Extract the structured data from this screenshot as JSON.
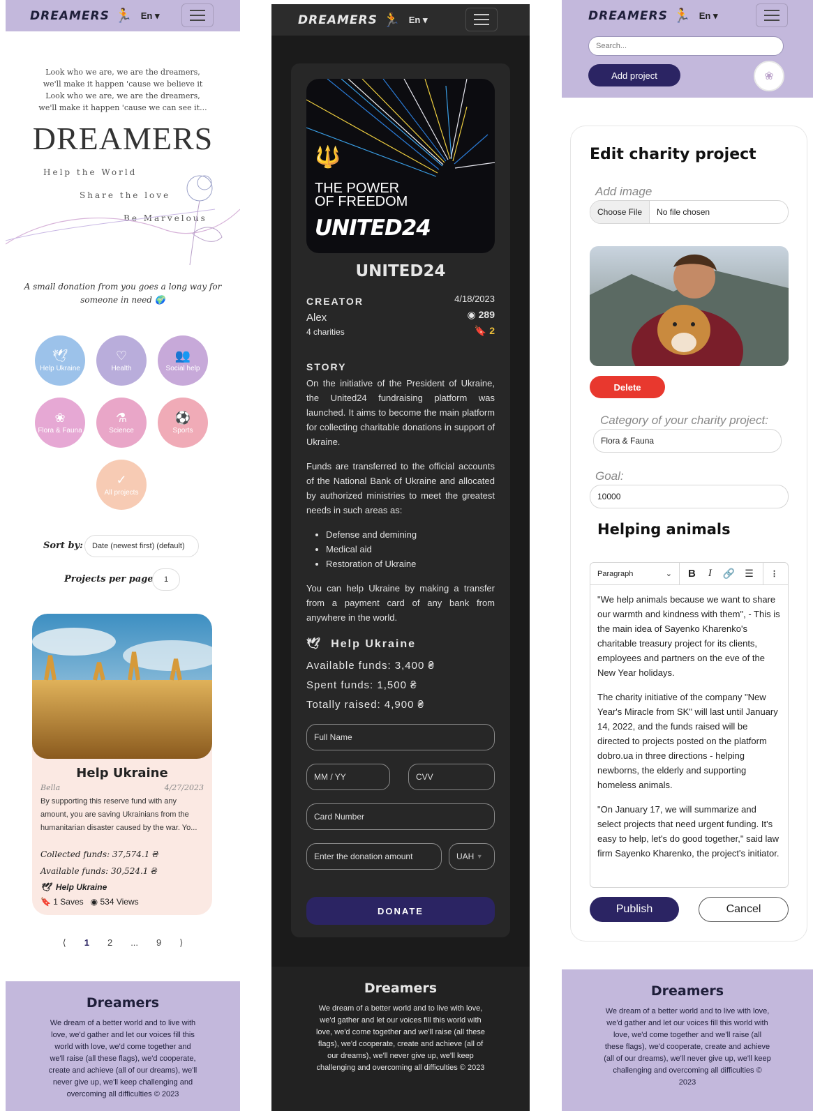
{
  "brand": {
    "logo_text": "DREAMERS",
    "lang": "En",
    "logo_icon": "dreamer-figure-icon",
    "burger_icon": "hamburger-menu-icon"
  },
  "home": {
    "poem": [
      "Look who we are, we are the dreamers,",
      "we'll make it happen 'cause we believe it",
      "Look who we are, we are the dreamers,",
      "we'll make it happen 'cause we can see it..."
    ],
    "big_title": "DREAMERS",
    "taglines": [
      "Help the World",
      "Share the love",
      "Be Marvelous"
    ],
    "subtitle": "A small donation from you goes a long way for someone in need",
    "categories": [
      {
        "label": "Help Ukraine",
        "icon": "dove-icon",
        "color": "#9cc2ea"
      },
      {
        "label": "Health",
        "icon": "heart-pulse-icon",
        "color": "#b9addb"
      },
      {
        "label": "Social help",
        "icon": "people-icon",
        "color": "#c7a9d9"
      },
      {
        "label": "Flora & Fauna",
        "icon": "paw-leaf-icon",
        "color": "#e6a8d4"
      },
      {
        "label": "Science",
        "icon": "flask-icon",
        "color": "#e9a6c8"
      },
      {
        "label": "Sports",
        "icon": "ball-icon",
        "color": "#f0abb7"
      },
      {
        "label": "All projects",
        "icon": "check-icon",
        "color": "#f7cbb4"
      }
    ],
    "sort_label": "Sort by:",
    "sort_value": "Date (newest first) (default)",
    "per_page_label": "Projects per page:",
    "per_page_value": "1",
    "card": {
      "title": "Help Ukraine",
      "author": "Bella",
      "date": "4/27/2023",
      "desc": "By supporting this reserve fund with any amount, you are saving Ukrainians from the humanitarian disaster caused by the war. Yo...",
      "collected": "Collected funds: 37,574.1 ₴",
      "available": "Available funds: 30,524.1 ₴",
      "category": "Help Ukraine",
      "saves": "1 Saves",
      "views": "534 Views"
    },
    "pagination": [
      "⟨",
      "1",
      "2",
      "...",
      "9",
      "⟩"
    ]
  },
  "detail": {
    "poster_line1": "THE POWER",
    "poster_line2": "OF FREEDOM",
    "poster_brand": "UNITED24",
    "title": "UNITED24",
    "creator_label": "CREATOR",
    "creator_name": "Alex",
    "creator_charities": "4 charities",
    "date": "4/18/2023",
    "views": "289",
    "saves": "2",
    "story_label": "STORY",
    "story_p1": "On the initiative of the President of Ukraine, the United24 fundraising platform was launched. It aims to become the main platform for collecting charitable donations in support of Ukraine.",
    "story_p2": "Funds are transferred to the official accounts of the National Bank of Ukraine and allocated by authorized ministries to meet the greatest needs in such areas as:",
    "story_list": [
      "Defense and demining",
      "Medical aid",
      "Restoration of Ukraine"
    ],
    "story_p3": "You can help Ukraine by making a transfer from a payment card of any bank from anywhere in the world.",
    "category": "Help Ukraine",
    "available": "Available funds: 3,400 ₴",
    "spent": "Spent funds: 1,500 ₴",
    "raised": "Totally raised: 4,900 ₴",
    "full_name_ph": "Full Name",
    "mmyy_ph": "MM / YY",
    "cvv_ph": "CVV",
    "card_ph": "Card Number",
    "amount_ph": "Enter the donation amount",
    "currency": "UAH",
    "donate": "DONATE"
  },
  "edit": {
    "search_ph": "Search...",
    "add_project": "Add project",
    "title": "Edit charity project",
    "add_image": "Add image",
    "choose_file": "Choose File",
    "no_file": "No file chosen",
    "delete": "Delete",
    "category_label": "Category of your charity project:",
    "category_value": "Flora & Fauna",
    "goal_label": "Goal:",
    "goal_value": "10000",
    "project_name": "Helping animals",
    "paragraph": "Paragraph",
    "body_p1": "\"We help animals because we want to share our warmth and kindness with them\", - This is the main idea of Sayenko Kharenko's charitable treasury project for its clients, employees and partners on the eve of the New Year holidays.",
    "body_p2": "The charity initiative of the company \"New Year's Miracle from SK\" will last until January 14, 2022, and the funds raised will be directed to projects posted on the platform dobro.ua in three directions - helping newborns, the elderly and supporting homeless animals.",
    "body_p3": "\"On January 17, we will summarize and select projects that need urgent funding. It's easy to help, let's do good together,\" said law firm Sayenko Kharenko, the project's initiator.",
    "publish": "Publish",
    "cancel": "Cancel"
  },
  "footer": {
    "title": "Dreamers",
    "text": "We dream of a better world and to live with love, we'd gather and let our voices fill this world with love, we'd come together and we'll raise (all these flags), we'd cooperate, create and achieve (all of our dreams), we'll never give up, we'll keep challenging and overcoming all difficulties © 2023"
  },
  "colors": {
    "lavender": "#c3b8dc",
    "navy": "#2b2463",
    "delete_red": "#e8382e",
    "save_yellow": "#f0c23a"
  }
}
